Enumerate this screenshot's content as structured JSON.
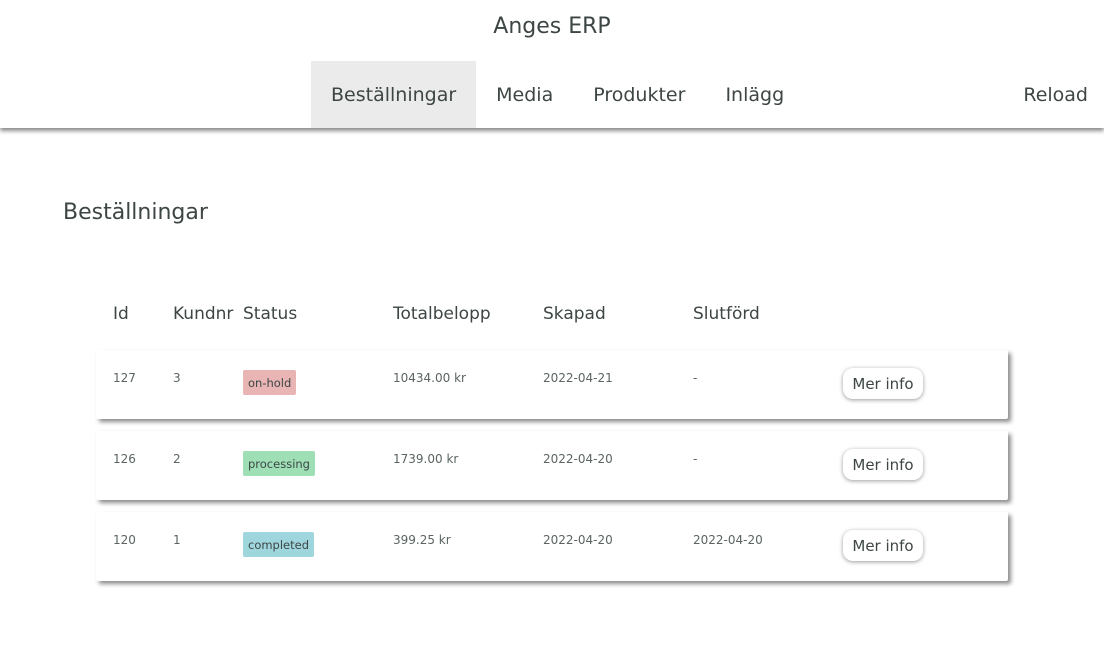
{
  "app": {
    "title": "Anges ERP"
  },
  "nav": {
    "items": [
      {
        "label": "Beställningar",
        "active": true
      },
      {
        "label": "Media",
        "active": false
      },
      {
        "label": "Produkter",
        "active": false
      },
      {
        "label": "Inlägg",
        "active": false
      }
    ],
    "reload_label": "Reload"
  },
  "page": {
    "title": "Beställningar"
  },
  "table": {
    "columns": [
      "Id",
      "Kundnr",
      "Status",
      "Totalbelopp",
      "Skapad",
      "Slutförd"
    ],
    "rows": [
      {
        "id": "127",
        "customer": "3",
        "status": "on-hold",
        "status_color": "#e8b4b4",
        "total": "10434.00 kr",
        "created": "2022-04-21",
        "completed": "-",
        "action": "Mer info"
      },
      {
        "id": "126",
        "customer": "2",
        "status": "processing",
        "status_color": "#9edfb6",
        "total": "1739.00 kr",
        "created": "2022-04-20",
        "completed": "-",
        "action": "Mer info"
      },
      {
        "id": "120",
        "customer": "1",
        "status": "completed",
        "status_color": "#9fd6de",
        "total": "399.25 kr",
        "created": "2022-04-20",
        "completed": "2022-04-20",
        "action": "Mer info"
      }
    ]
  },
  "colors": {
    "text": "#3d4645",
    "nav_active_bg": "#ebebeb"
  }
}
